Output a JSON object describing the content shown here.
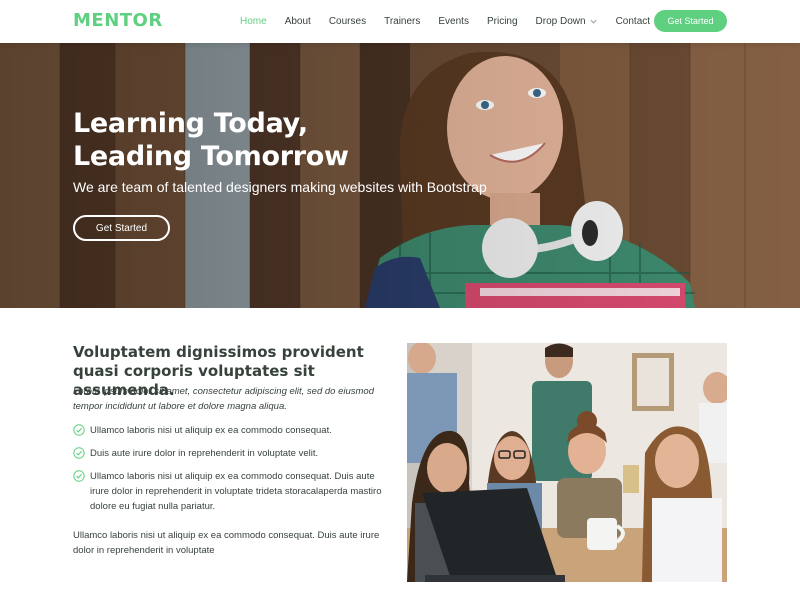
{
  "brand": {
    "logo": "MENTOR",
    "accent": "#5fcf80"
  },
  "nav": {
    "items": [
      {
        "label": "Home",
        "active": true
      },
      {
        "label": "About"
      },
      {
        "label": "Courses"
      },
      {
        "label": "Trainers"
      },
      {
        "label": "Events"
      },
      {
        "label": "Pricing"
      },
      {
        "label": "Drop Down",
        "has_dropdown": true
      },
      {
        "label": "Contact"
      }
    ],
    "cta_label": "Get Started"
  },
  "hero": {
    "title_line1": "Learning Today,",
    "title_line2": "Leading Tomorrow",
    "subtitle": "We are team of talented designers making websites with Bootstrap",
    "button_label": "Get Started"
  },
  "about": {
    "title": "Voluptatem dignissimos provident quasi corporis voluptates sit assumenda.",
    "italic": "Lorem ipsum dolor sit amet, consectetur adipiscing elit, sed do eiusmod tempor incididunt ut labore et dolore magna aliqua.",
    "checks": [
      "Ullamco laboris nisi ut aliquip ex ea commodo consequat.",
      "Duis aute irure dolor in reprehenderit in voluptate velit.",
      "Ullamco laboris nisi ut aliquip ex ea commodo consequat. Duis aute irure dolor in reprehenderit in voluptate trideta storacalaperda mastiro dolore eu fugiat nulla pariatur."
    ],
    "paragraph": "Ullamco laboris nisi ut aliquip ex ea commodo consequat. Duis aute irure dolor in reprehenderit in voluptate"
  }
}
